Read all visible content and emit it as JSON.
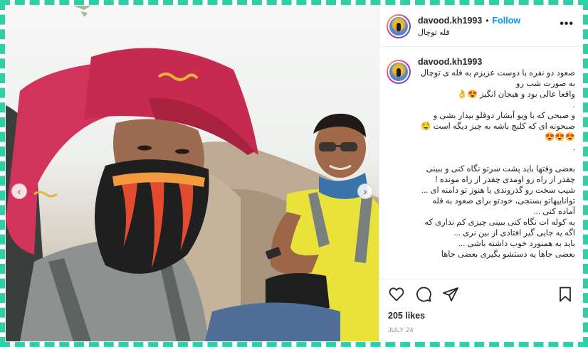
{
  "post": {
    "username": "davood.kh1993",
    "follow_label": "Follow",
    "separator": "•",
    "location": "قله توچال",
    "caption_username": "davood.kh1993",
    "caption": "صعود دو نفره با دوست عزیزم به قله ی توچال به صورت شب رو\nواقعا عالی بود و هیجان انگیز 😍👌\n.\nو صبحی که با ویو آبشار دوقلو بیدار بشی و صبحونه ای که کلبچ باشه به چیز دیگه است 🤤😍😍😍\n.\n\nبعضی وقتها باید پشت سرتو نگاه کنی و ببینی چقدر از راه رو اومدی چقدر از راه مونده !\nشیب سخت رو گذروندی یا هنوز تو دامنه ای ...\nتواناییهاتو بسنجی، خودتو برای صعود به قله آماده کنی ...\nبه کوله ات نگاه کنی ببینی چیزی کم نداری که اگه یه جایی گیر افتادی از بین نری ...\nباید به همنورد خوب داشته باشی ...\nبعضی جاها یه دستشو بگیری بعضی جاها",
    "likes": "205 likes",
    "date": "JULY 24"
  },
  "icons": {
    "more": "more-options-icon",
    "like": "heart-icon",
    "comment": "comment-icon",
    "share": "paper-plane-icon",
    "save": "bookmark-icon",
    "prev": "chevron-left-icon",
    "next": "chevron-right-icon"
  },
  "nav": {
    "prev_glyph": "‹",
    "next_glyph": "›"
  },
  "colors": {
    "accent": "#0095f6",
    "border_dash": "#2fd0a8"
  }
}
